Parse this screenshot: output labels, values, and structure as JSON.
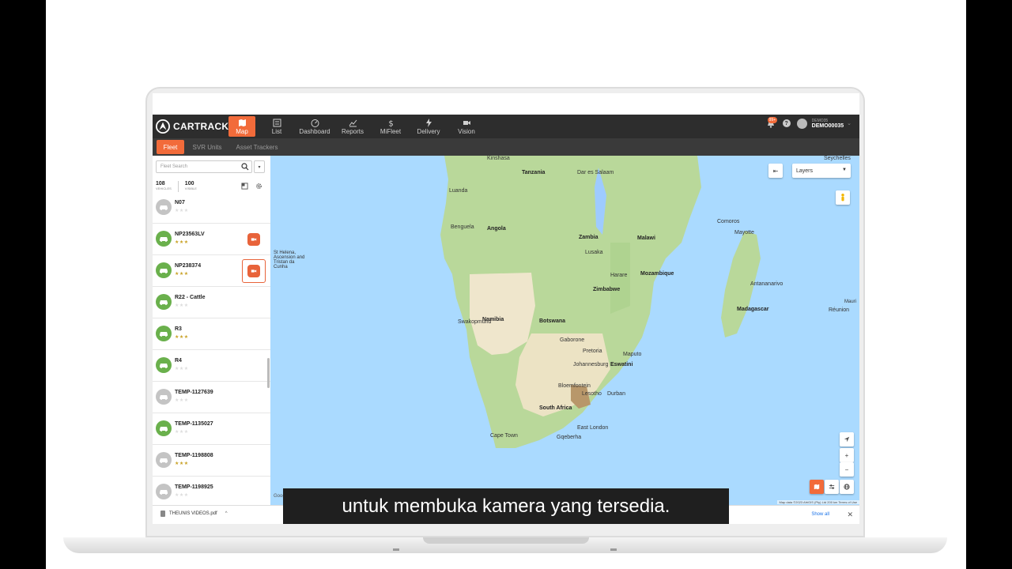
{
  "app": {
    "logo_text": "CARTRACK",
    "nav": [
      {
        "label": "Map",
        "icon": "map-icon",
        "active": true
      },
      {
        "label": "List",
        "icon": "list-icon",
        "active": false
      },
      {
        "label": "Dashboard",
        "icon": "dashboard-icon",
        "active": false
      },
      {
        "label": "Reports",
        "icon": "reports-icon",
        "active": false
      },
      {
        "label": "MiFleet",
        "icon": "dollar-icon",
        "active": false
      },
      {
        "label": "Delivery",
        "icon": "bolt-icon",
        "active": false
      },
      {
        "label": "Vision",
        "icon": "video-camera-icon",
        "active": false
      }
    ],
    "notification_count": "99+",
    "help_label": "?",
    "user": {
      "sub": "DEMO35",
      "name": "DEMO00035"
    },
    "caret": "⌄"
  },
  "subtabs": [
    {
      "label": "Fleet",
      "active": true
    },
    {
      "label": "SVR Units",
      "active": false
    },
    {
      "label": "Asset Trackers",
      "active": false
    }
  ],
  "sidebar": {
    "search_placeholder": "Fleet Search",
    "filter_caret": "▾",
    "vehicles_count": "108",
    "vehicles_label": "VEHICLES",
    "visible_count": "100",
    "visible_label": "VISIBLE",
    "vehicles": [
      {
        "name": "N07",
        "status": "grey",
        "stars": 0,
        "camera": "none"
      },
      {
        "name": "NP23563LV",
        "status": "green",
        "stars": 3,
        "camera": "solid"
      },
      {
        "name": "NP238374",
        "status": "green",
        "stars": 3,
        "camera": "outlined"
      },
      {
        "name": "R22 - Cattle",
        "status": "green",
        "stars": 0,
        "camera": "none"
      },
      {
        "name": "R3",
        "status": "green",
        "stars": 3,
        "camera": "none"
      },
      {
        "name": "R4",
        "status": "green",
        "stars": 0,
        "camera": "none"
      },
      {
        "name": "TEMP-1127639",
        "status": "grey",
        "stars": 0,
        "camera": "none"
      },
      {
        "name": "TEMP-1135027",
        "status": "green",
        "stars": 0,
        "camera": "none"
      },
      {
        "name": "TEMP-1198808",
        "status": "grey",
        "stars": 3,
        "camera": "none"
      },
      {
        "name": "TEMP-1198925",
        "status": "grey",
        "stars": 0,
        "camera": "none"
      }
    ]
  },
  "map": {
    "layers_label": "Layers",
    "collapse_label": "⇤",
    "zoom_in": "+",
    "zoom_out": "−",
    "attribution": "Map data ©2023 AfriGIS (Pty) Ltd   200 km   Terms of Use",
    "google_label": "Google",
    "labels": [
      {
        "text": "Tanzania",
        "cls": "bold"
      },
      {
        "text": "Dar es Salaam",
        "cls": ""
      },
      {
        "text": "Seychelles",
        "cls": ""
      },
      {
        "text": "Kinshasa",
        "cls": ""
      },
      {
        "text": "Luanda",
        "cls": ""
      },
      {
        "text": "Angola",
        "cls": "bold"
      },
      {
        "text": "Benguela",
        "cls": ""
      },
      {
        "text": "Zambia",
        "cls": "bold"
      },
      {
        "text": "Malawi",
        "cls": "bold"
      },
      {
        "text": "Lusaka",
        "cls": ""
      },
      {
        "text": "Comoros",
        "cls": ""
      },
      {
        "text": "Mayotte",
        "cls": ""
      },
      {
        "text": "St Helena, Ascension and Tristan da Cunha",
        "cls": ""
      },
      {
        "text": "Harare",
        "cls": ""
      },
      {
        "text": "Mozambique",
        "cls": "bold"
      },
      {
        "text": "Zimbabwe",
        "cls": "bold"
      },
      {
        "text": "Antananarivo",
        "cls": ""
      },
      {
        "text": "Madagascar",
        "cls": "bold"
      },
      {
        "text": "Mauri",
        "cls": ""
      },
      {
        "text": "Réunion",
        "cls": ""
      },
      {
        "text": "Namibia",
        "cls": "bold"
      },
      {
        "text": "Botswana",
        "cls": "bold"
      },
      {
        "text": "Swakopmund",
        "cls": ""
      },
      {
        "text": "Gaborone",
        "cls": ""
      },
      {
        "text": "Pretoria",
        "cls": ""
      },
      {
        "text": "Maputo",
        "cls": ""
      },
      {
        "text": "Johannesburg",
        "cls": ""
      },
      {
        "text": "Eswatini",
        "cls": "bold"
      },
      {
        "text": "Bloemfontein",
        "cls": ""
      },
      {
        "text": "Lesotho",
        "cls": ""
      },
      {
        "text": "Durban",
        "cls": ""
      },
      {
        "text": "South Africa",
        "cls": "bold"
      },
      {
        "text": "East London",
        "cls": ""
      },
      {
        "text": "Cape Town",
        "cls": ""
      },
      {
        "text": "Gqeberha",
        "cls": ""
      }
    ]
  },
  "download_bar": {
    "file": "THEUNIS VIDEOS.pdf",
    "caret": "^",
    "show_all": "Show all",
    "close": "✕"
  },
  "caption": "untuk membuka kamera yang tersedia.",
  "colors": {
    "accent": "#f26b3a",
    "status_green": "#6ab04c",
    "status_grey": "#c4c4c4",
    "star_gold": "#c9a227",
    "star_empty": "#dddddd"
  }
}
